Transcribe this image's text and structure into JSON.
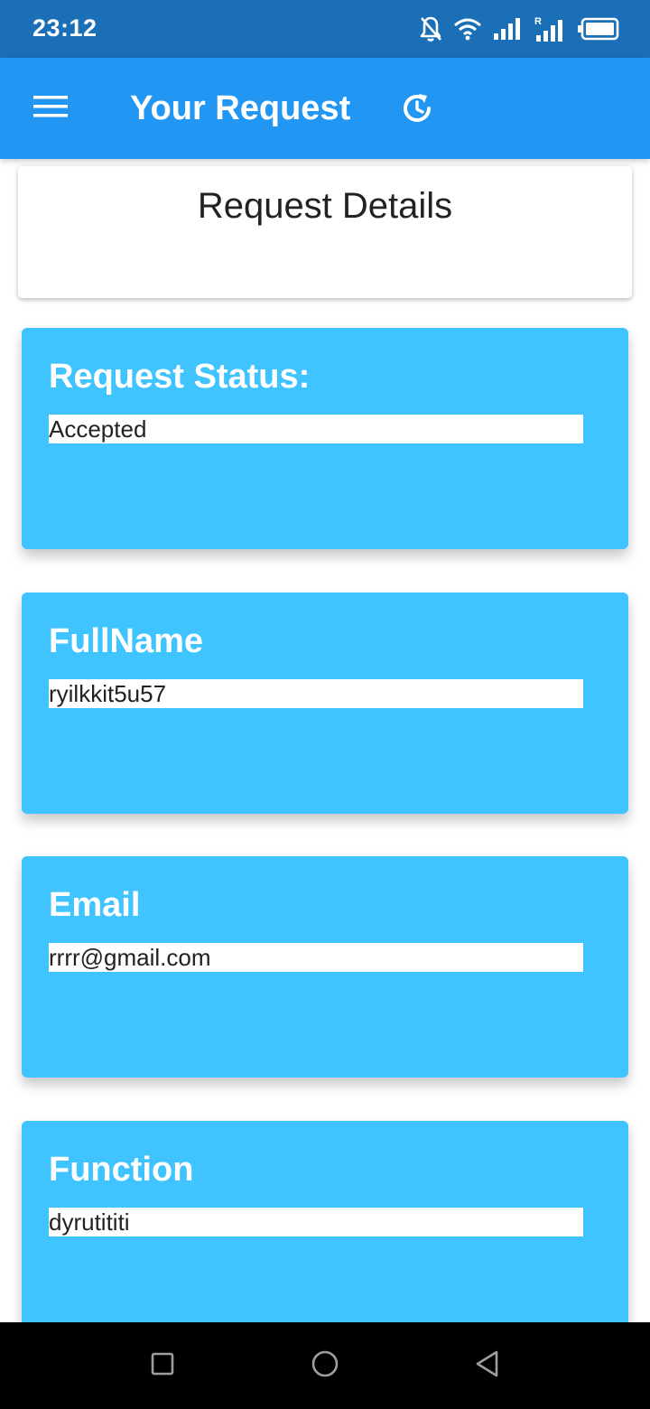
{
  "status_bar": {
    "time": "23:12",
    "icons": [
      "notifications-off-icon",
      "wifi-icon",
      "signal-icon",
      "roaming-signal-icon",
      "battery-icon"
    ]
  },
  "app_bar": {
    "title": "Your Request",
    "menu_icon": "menu-icon",
    "refresh_icon": "refresh-icon"
  },
  "header": {
    "title": "Request Details"
  },
  "cards": [
    {
      "label": "Request Status:",
      "value": "Accepted"
    },
    {
      "label": "FullName",
      "value": "ryilkkit5u57"
    },
    {
      "label": "Email",
      "value": "rrrr@gmail.com"
    },
    {
      "label": "Function",
      "value": "dyrutititi"
    }
  ],
  "nav": {
    "icons": [
      "recent-apps-icon",
      "home-icon",
      "back-icon"
    ]
  },
  "colors": {
    "status_bar": "#1b6fb6",
    "app_bar": "#2196f3",
    "card": "#40c4ff",
    "nav_bar": "#000000"
  }
}
